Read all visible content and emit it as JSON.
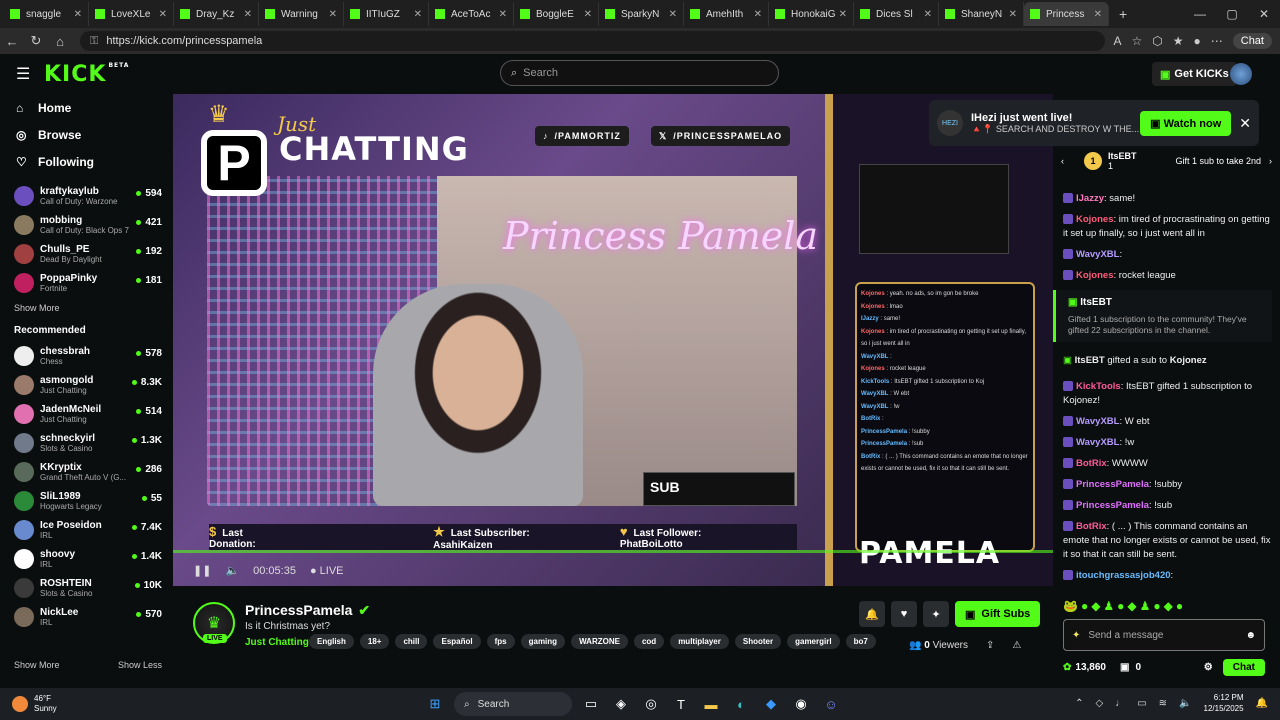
{
  "browser": {
    "tabs": [
      {
        "label": "snaggle"
      },
      {
        "label": "LoveXLe"
      },
      {
        "label": "Dray_Kz"
      },
      {
        "label": "Warning"
      },
      {
        "label": "IITIuGZ"
      },
      {
        "label": "AceToAc"
      },
      {
        "label": "BoggleE"
      },
      {
        "label": "SparkyN"
      },
      {
        "label": "AmehIth"
      },
      {
        "label": "HonokaiGam"
      },
      {
        "label": "Dices Sl"
      },
      {
        "label": "ShaneyN"
      },
      {
        "label": "Princess"
      }
    ],
    "url": "https://kick.com/princesspamela",
    "chat_button": "Chat"
  },
  "header": {
    "logo": "KICK",
    "beta": "BETA",
    "search_placeholder": "Search",
    "get_kicks": "Get KICKs"
  },
  "sidebar": {
    "nav": [
      {
        "label": "Home",
        "icon": "home-icon"
      },
      {
        "label": "Browse",
        "icon": "compass-icon"
      },
      {
        "label": "Following",
        "icon": "heart-icon"
      }
    ],
    "following": [
      {
        "name": "kraftykaylub",
        "category": "Call of Duty: Warzone",
        "viewers": "594",
        "color": "#6b4fbf"
      },
      {
        "name": "mobbing",
        "category": "Call of Duty: Black Ops 7",
        "viewers": "421",
        "color": "#8a7a60"
      },
      {
        "name": "Chulls_PE",
        "category": "Dead By Daylight",
        "viewers": "192",
        "color": "#a04040"
      },
      {
        "name": "PoppaPinky",
        "category": "Fortnite",
        "viewers": "181",
        "color": "#c02060"
      }
    ],
    "show_more": "Show More",
    "recommended_title": "Recommended",
    "recommended": [
      {
        "name": "chessbrah",
        "category": "Chess",
        "viewers": "578",
        "color": "#eeeeee"
      },
      {
        "name": "asmongold",
        "category": "Just Chatting",
        "viewers": "8.3K",
        "color": "#9a7a6a"
      },
      {
        "name": "JadenMcNeil",
        "category": "Just Chatting",
        "viewers": "514",
        "color": "#e070b0"
      },
      {
        "name": "schneckyirl",
        "category": "Slots & Casino",
        "viewers": "1.3K",
        "color": "#707a8a"
      },
      {
        "name": "KKryptix",
        "category": "Grand Theft Auto V (G...",
        "viewers": "286",
        "color": "#5a6a5a"
      },
      {
        "name": "SliL1989",
        "category": "Hogwarts Legacy",
        "viewers": "55",
        "color": "#2a8a3a"
      },
      {
        "name": "Ice Poseidon",
        "category": "IRL",
        "viewers": "7.4K",
        "color": "#6a8ad0"
      },
      {
        "name": "shoovy",
        "category": "IRL",
        "viewers": "1.4K",
        "color": "#ffffff"
      },
      {
        "name": "ROSHTEIN",
        "category": "Slots & Casino",
        "viewers": "10K",
        "color": "#3a3a3a"
      },
      {
        "name": "NickLee",
        "category": "IRL",
        "viewers": "570",
        "color": "#7a6a5a"
      }
    ],
    "footer_more": "Show More",
    "footer_less": "Show Less"
  },
  "video": {
    "overlay_just": "Just",
    "overlay_chatting": "CHATTING",
    "tiktok": "/PAMMORTIZ",
    "twitter": "/PRINCESSPAMELAO",
    "neon_sign": "Princess Pamela",
    "sub_box": "SUB",
    "last_donation": "Last Donation:",
    "last_subscriber": "Last Subscriber: AsahiKaizen",
    "last_follower": "Last Follower: PhatBoiLotto",
    "overlay_name_script": "Princess",
    "overlay_name": "PAMELA",
    "time": "00:05:35",
    "live": "LIVE",
    "overlay_chat": [
      {
        "user": "Kojones",
        "text": "yeah. no ads, so im gon be broke",
        "red": true
      },
      {
        "user": "Kojones",
        "text": "lmao",
        "red": true
      },
      {
        "user": "IJazzy",
        "text": "same!",
        "red": false
      },
      {
        "user": "Kojones",
        "text": "im tired of procrastinating on getting it set up finally, so i just went all in",
        "red": true
      },
      {
        "user": "WavyXBL",
        "text": "",
        "red": false
      },
      {
        "user": "Kojones",
        "text": "rocket league",
        "red": true
      },
      {
        "user": "KickTools",
        "text": "ItsEBT gifted 1 subscription to Koj",
        "red": false
      },
      {
        "user": "WavyXBL",
        "text": "W ebt",
        "red": false
      },
      {
        "user": "WavyXBL",
        "text": "!w",
        "red": false
      },
      {
        "user": "BotRix",
        "text": "",
        "red": false
      },
      {
        "user": "PrincessPamela",
        "text": "!subby",
        "red": false
      },
      {
        "user": "PrincessPamela",
        "text": "!sub",
        "red": false
      },
      {
        "user": "BotRix",
        "text": "( ... ) This command contains an emote that no longer exists or cannot be used, fix it so that it can still be sent.",
        "red": false
      }
    ]
  },
  "stream": {
    "name": "PrincessPamela",
    "live_badge": "LIVE",
    "title": "Is it Christmas yet?",
    "category": "Just Chatting",
    "tags": [
      "English",
      "18+",
      "chill",
      "Español",
      "fps",
      "gaming",
      "WARZONE",
      "cod",
      "multiplayer",
      "Shooter",
      "gamergirl",
      "bo7"
    ],
    "gift_subs": "Gift Subs",
    "viewers_count": "0",
    "viewers_label": "Viewers"
  },
  "notification": {
    "title": "IHezi just went live!",
    "subtitle": "🔺📍 SEARCH AND DESTROY W THE...",
    "watch_now": "Watch now",
    "avatar_text": "HEZI"
  },
  "chat": {
    "gift_leader": "ItsEBT",
    "gift_count": "1",
    "gift_leader_sub": "1",
    "gift_prompt": "Gift 1 sub to take 2nd",
    "messages_top": [
      {
        "user": "IJazzy",
        "text": "same!",
        "color": "#ff7abf"
      },
      {
        "user": "Kojones",
        "text": "im tired of procrastinating on getting it set up finally, so i just went all in",
        "color": "#ff5a7a"
      },
      {
        "user": "WavyXBL",
        "text": "",
        "color": "#b59bff"
      },
      {
        "user": "Kojones",
        "text": "rocket league",
        "color": "#ff5a7a"
      }
    ],
    "system1_title": "ItsEBT",
    "system1_text": "Gifted 1 subscription to the community! They've gifted 22 subscriptions in the channel.",
    "system2_user": "ItsEBT",
    "system2_mid": " gifted a sub to ",
    "system2_target": "Kojonez",
    "messages_bottom": [
      {
        "user": "KickTools",
        "text": "ItsEBT gifted 1 subscription to Kojonez!",
        "color": "#ff5a9a"
      },
      {
        "user": "WavyXBL",
        "text": "W ebt",
        "color": "#b59bff"
      },
      {
        "user": "WavyXBL",
        "text": "!w",
        "color": "#b59bff"
      },
      {
        "user": "BotRix",
        "text": "WWWW",
        "color": "#ff5a9a"
      },
      {
        "user": "PrincessPamela",
        "text": "!subby",
        "color": "#e070ff"
      },
      {
        "user": "PrincessPamela",
        "text": "!sub",
        "color": "#e070ff"
      },
      {
        "user": "BotRix",
        "text": "( ... ) This command contains an emote that no longer exists or cannot be used, fix it so that it can still be sent.",
        "color": "#ff5a9a"
      },
      {
        "user": "itouchgrassasjob420",
        "text": "",
        "color": "#6bf"
      }
    ],
    "send_placeholder": "Send a message",
    "kicks": "13,860",
    "gift_count_footer": "0",
    "chat_button": "Chat"
  },
  "taskbar": {
    "temp": "46°F",
    "weather": "Sunny",
    "search": "Search",
    "time": "6:12 PM",
    "date": "12/15/2025"
  }
}
